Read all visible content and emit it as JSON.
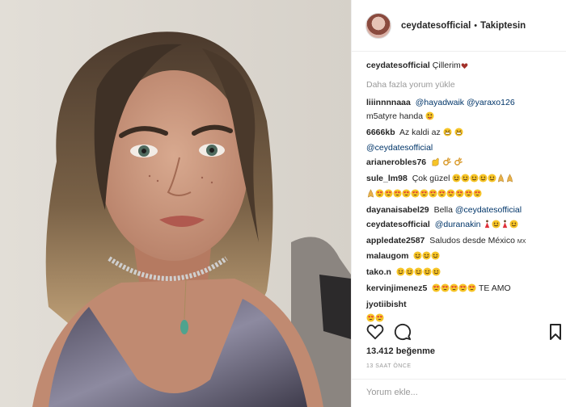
{
  "post": {
    "username": "ceydatesofficial",
    "separator": "•",
    "follow_status": "Takiptesin",
    "caption_text": "Çillerim",
    "load_more": "Daha fazla yorum yükle",
    "likes": "13.412 beğenme",
    "time_ago": "13 SAAT ÖNCE",
    "add_comment_placeholder": "Yorum ekle..."
  },
  "comments": [
    {
      "user": "liiinnnnaaa",
      "mention1": "@hayadwaik",
      "mention2": "@yaraxo126",
      "text": "m5atyre handa"
    },
    {
      "user": "6666kb",
      "text": "Az kaldi az",
      "mention": "@ceydatesofficial"
    },
    {
      "user": "arianerobles76"
    },
    {
      "user": "sule_lm98",
      "text": "Çok güzel"
    },
    {
      "user": "dayanaisabel29",
      "text": "Bella",
      "mention": "@ceydatesofficial"
    },
    {
      "user": "ceydatesofficial",
      "mention": "@duranakin"
    },
    {
      "user": "appledate2587",
      "text": "Saludos desde México",
      "suffix": "MX"
    },
    {
      "user": "malaugom"
    },
    {
      "user": "tako.n"
    },
    {
      "user": "kervinjimenez5",
      "text": "TE AMO"
    },
    {
      "user": "jyotiibisht"
    }
  ],
  "icons": {
    "like": "heart-icon",
    "comment": "comment-bubble-icon",
    "save": "bookmark-icon",
    "face": "smiley-emoji-icon",
    "hands": "praying-hands-emoji-icon",
    "heart_eyes": "heart-eyes-emoji-icon",
    "grin": "grinning-emoji-icon",
    "dancer": "dancer-emoji-icon"
  },
  "colors": {
    "text": "#262626",
    "muted": "#999999",
    "mention": "#003569",
    "border": "#efefef",
    "emoji_yellow": "#f6c427"
  }
}
